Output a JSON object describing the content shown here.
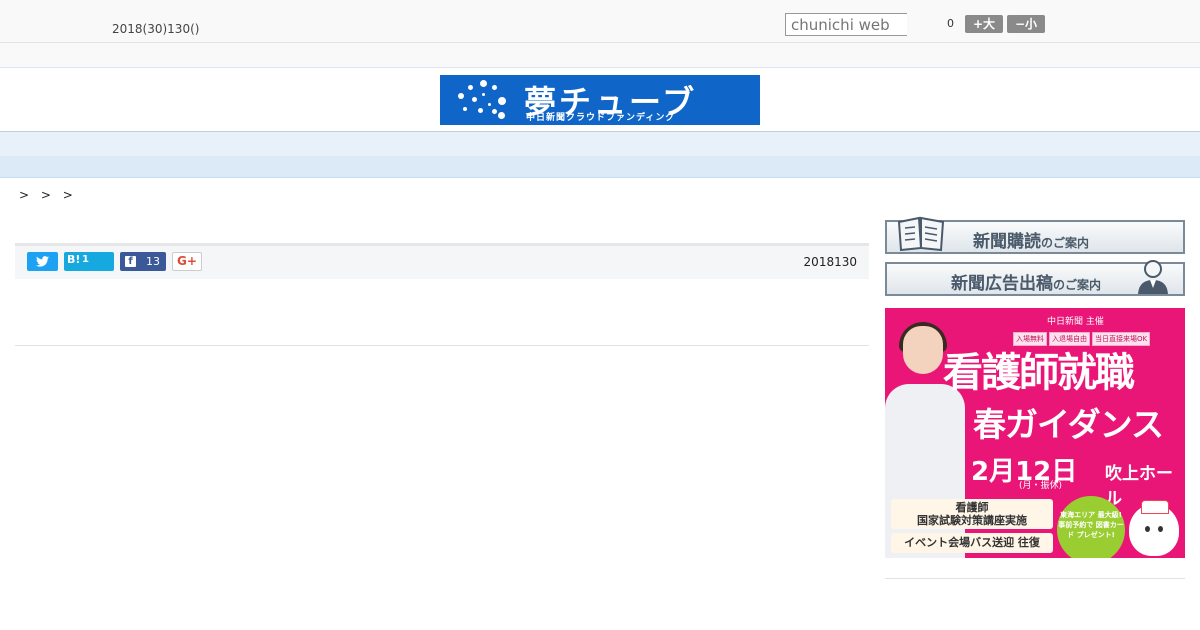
{
  "header": {
    "date_text": "2018(30)130()",
    "search_placeholder": "chunichi web",
    "font_size_count": "0",
    "font_larger_label": "+大",
    "font_smaller_label": "−小"
  },
  "logo": {
    "title": "夢チューブ",
    "subtitle": "中日新聞クラウドファンディング",
    "bg_color": "#1066c8"
  },
  "nav": {
    "items": [
      "",
      "",
      "",
      "",
      "",
      "",
      "",
      "",
      ""
    ]
  },
  "breadcrumb": {
    "text": "> > >"
  },
  "share": {
    "twitter_icon": "twitter-bird-icon",
    "hatena_label": "B!",
    "hatena_count": "1",
    "facebook_label": "f",
    "facebook_count": "13",
    "gplus_label": "G+",
    "publish_date": "2018130"
  },
  "sidebar": {
    "banner1_main": "新聞購読",
    "banner1_sub": "のご案内",
    "banner2_main": "新聞広告出稿",
    "banner2_sub": "のご案内"
  },
  "ad": {
    "sponsor": "中日新聞 主催",
    "tags": [
      "入場無料",
      "入退場自由",
      "当日直接来場OK"
    ],
    "headline1": "看護師就職",
    "headline2": "春ガイダンス",
    "date": "2月12日",
    "date_sub": "(月・振休)",
    "venue": "吹上ホール",
    "box1_line1": "看護師",
    "box1_line2": "国家試験対策講座実施",
    "box2": "イベント会場バス送迎 往復",
    "circle_text": "東海エリア 最大級! 事前予約で 図書カード プレゼント!",
    "bg_color": "#ea1677"
  }
}
